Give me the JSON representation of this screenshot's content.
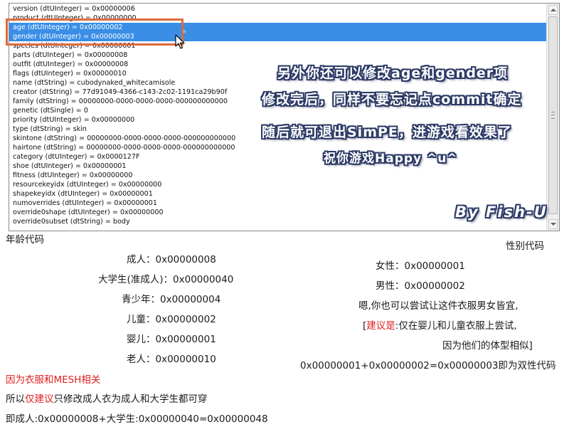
{
  "listbox": {
    "items": [
      {
        "text": "version (dtUInteger) = 0x00000006",
        "selected": false
      },
      {
        "text": "product (dtUInteger) = 0x00000000",
        "selected": false
      },
      {
        "text": "age (dtUInteger) = 0x00000002",
        "selected": true
      },
      {
        "text": "gender (dtUInteger) = 0x00000003",
        "selected": true
      },
      {
        "text": "species (dtUInteger) = 0x00000001",
        "selected": false
      },
      {
        "text": "parts (dtUInteger) = 0x00000008",
        "selected": false
      },
      {
        "text": "outfit (dtUInteger) = 0x00000008",
        "selected": false
      },
      {
        "text": "flags (dtUInteger) = 0x00000010",
        "selected": false
      },
      {
        "text": "name (dtString) = cubodynaked_whitecamisole",
        "selected": false
      },
      {
        "text": "creator (dtString) = 77d91049-4366-c143-2c02-1191ca29b90f",
        "selected": false
      },
      {
        "text": "family (dtString) = 00000000-0000-0000-0000-000000000000",
        "selected": false
      },
      {
        "text": "genetic (dtSingle) = 0",
        "selected": false
      },
      {
        "text": "priority (dtUInteger) = 0x00000000",
        "selected": false
      },
      {
        "text": "type (dtString) = skin",
        "selected": false
      },
      {
        "text": "skintone (dtString) = 00000000-0000-0000-0000-000000000000",
        "selected": false
      },
      {
        "text": "hairtone (dtString) = 00000000-0000-0000-0000-000000000000",
        "selected": false
      },
      {
        "text": "category (dtUInteger) = 0x0000127F",
        "selected": false
      },
      {
        "text": "shoe (dtUInteger) = 0x00000001",
        "selected": false
      },
      {
        "text": "fitness (dtUInteger) = 0x00000000",
        "selected": false
      },
      {
        "text": "resourcekeyidx (dtUInteger) = 0x00000000",
        "selected": false
      },
      {
        "text": "shapekeyidx (dtUInteger) = 0x00000001",
        "selected": false
      },
      {
        "text": "numoverrides (dtUInteger) = 0x00000001",
        "selected": false
      },
      {
        "text": "override0shape (dtUInteger) = 0x00000000",
        "selected": false
      },
      {
        "text": "override0subset (dtString) = body",
        "selected": false
      }
    ]
  },
  "overlay": {
    "line1": "另外你还可以修改age和gender项",
    "line2": "修改完后，同样不要忘记点commit确定",
    "line3": "随后就可退出SimPE，进游戏看效果了",
    "line4": "祝你游戏Happy ^u^",
    "author": "By Fish-U"
  },
  "age_section": {
    "title": "年龄代码",
    "entries": [
      "成人：0x00000008",
      "大学生(准成人)：0x00000040",
      "青少年：0x00000004",
      "儿童：0x00000002",
      "婴儿：0x00000001",
      "老人：0x00000010"
    ],
    "note_red": "因为衣服和MESH相关",
    "note2_pre": "所以",
    "note2_red": "仅建议",
    "note2_post": "只修改成人衣为成人和大学生都可穿",
    "note3": "即成人:0x00000008+大学生:0x00000040=0x00000048"
  },
  "gender_section": {
    "title": "性别代码",
    "female": "女性：0x00000001",
    "male": "男性：0x00000002",
    "note1": "嗯,你也可以尝试让这件衣服男女皆宜,",
    "note2_open": "[",
    "note2_red": "建议是",
    "note2_post": ":仅在婴儿和儿童衣服上尝试,",
    "note3": "因为他们的体型相似]",
    "note4": "0x00000001+0x00000002=0x00000003即为双性代码"
  },
  "colors": {
    "selection": "#3a8ee6",
    "highlight_frame": "#e06a3a",
    "overlay_outline": "#2c3a66",
    "red_text": "#e02020"
  }
}
